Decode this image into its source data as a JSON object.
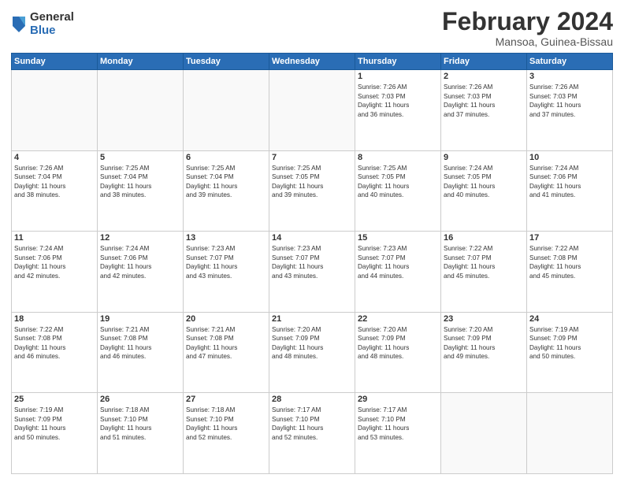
{
  "logo": {
    "general": "General",
    "blue": "Blue"
  },
  "header": {
    "title": "February 2024",
    "subtitle": "Mansoa, Guinea-Bissau"
  },
  "weekdays": [
    "Sunday",
    "Monday",
    "Tuesday",
    "Wednesday",
    "Thursday",
    "Friday",
    "Saturday"
  ],
  "weeks": [
    [
      {
        "day": "",
        "info": ""
      },
      {
        "day": "",
        "info": ""
      },
      {
        "day": "",
        "info": ""
      },
      {
        "day": "",
        "info": ""
      },
      {
        "day": "1",
        "info": "Sunrise: 7:26 AM\nSunset: 7:03 PM\nDaylight: 11 hours\nand 36 minutes."
      },
      {
        "day": "2",
        "info": "Sunrise: 7:26 AM\nSunset: 7:03 PM\nDaylight: 11 hours\nand 37 minutes."
      },
      {
        "day": "3",
        "info": "Sunrise: 7:26 AM\nSunset: 7:03 PM\nDaylight: 11 hours\nand 37 minutes."
      }
    ],
    [
      {
        "day": "4",
        "info": "Sunrise: 7:26 AM\nSunset: 7:04 PM\nDaylight: 11 hours\nand 38 minutes."
      },
      {
        "day": "5",
        "info": "Sunrise: 7:25 AM\nSunset: 7:04 PM\nDaylight: 11 hours\nand 38 minutes."
      },
      {
        "day": "6",
        "info": "Sunrise: 7:25 AM\nSunset: 7:04 PM\nDaylight: 11 hours\nand 39 minutes."
      },
      {
        "day": "7",
        "info": "Sunrise: 7:25 AM\nSunset: 7:05 PM\nDaylight: 11 hours\nand 39 minutes."
      },
      {
        "day": "8",
        "info": "Sunrise: 7:25 AM\nSunset: 7:05 PM\nDaylight: 11 hours\nand 40 minutes."
      },
      {
        "day": "9",
        "info": "Sunrise: 7:24 AM\nSunset: 7:05 PM\nDaylight: 11 hours\nand 40 minutes."
      },
      {
        "day": "10",
        "info": "Sunrise: 7:24 AM\nSunset: 7:06 PM\nDaylight: 11 hours\nand 41 minutes."
      }
    ],
    [
      {
        "day": "11",
        "info": "Sunrise: 7:24 AM\nSunset: 7:06 PM\nDaylight: 11 hours\nand 42 minutes."
      },
      {
        "day": "12",
        "info": "Sunrise: 7:24 AM\nSunset: 7:06 PM\nDaylight: 11 hours\nand 42 minutes."
      },
      {
        "day": "13",
        "info": "Sunrise: 7:23 AM\nSunset: 7:07 PM\nDaylight: 11 hours\nand 43 minutes."
      },
      {
        "day": "14",
        "info": "Sunrise: 7:23 AM\nSunset: 7:07 PM\nDaylight: 11 hours\nand 43 minutes."
      },
      {
        "day": "15",
        "info": "Sunrise: 7:23 AM\nSunset: 7:07 PM\nDaylight: 11 hours\nand 44 minutes."
      },
      {
        "day": "16",
        "info": "Sunrise: 7:22 AM\nSunset: 7:07 PM\nDaylight: 11 hours\nand 45 minutes."
      },
      {
        "day": "17",
        "info": "Sunrise: 7:22 AM\nSunset: 7:08 PM\nDaylight: 11 hours\nand 45 minutes."
      }
    ],
    [
      {
        "day": "18",
        "info": "Sunrise: 7:22 AM\nSunset: 7:08 PM\nDaylight: 11 hours\nand 46 minutes."
      },
      {
        "day": "19",
        "info": "Sunrise: 7:21 AM\nSunset: 7:08 PM\nDaylight: 11 hours\nand 46 minutes."
      },
      {
        "day": "20",
        "info": "Sunrise: 7:21 AM\nSunset: 7:08 PM\nDaylight: 11 hours\nand 47 minutes."
      },
      {
        "day": "21",
        "info": "Sunrise: 7:20 AM\nSunset: 7:09 PM\nDaylight: 11 hours\nand 48 minutes."
      },
      {
        "day": "22",
        "info": "Sunrise: 7:20 AM\nSunset: 7:09 PM\nDaylight: 11 hours\nand 48 minutes."
      },
      {
        "day": "23",
        "info": "Sunrise: 7:20 AM\nSunset: 7:09 PM\nDaylight: 11 hours\nand 49 minutes."
      },
      {
        "day": "24",
        "info": "Sunrise: 7:19 AM\nSunset: 7:09 PM\nDaylight: 11 hours\nand 50 minutes."
      }
    ],
    [
      {
        "day": "25",
        "info": "Sunrise: 7:19 AM\nSunset: 7:09 PM\nDaylight: 11 hours\nand 50 minutes."
      },
      {
        "day": "26",
        "info": "Sunrise: 7:18 AM\nSunset: 7:10 PM\nDaylight: 11 hours\nand 51 minutes."
      },
      {
        "day": "27",
        "info": "Sunrise: 7:18 AM\nSunset: 7:10 PM\nDaylight: 11 hours\nand 52 minutes."
      },
      {
        "day": "28",
        "info": "Sunrise: 7:17 AM\nSunset: 7:10 PM\nDaylight: 11 hours\nand 52 minutes."
      },
      {
        "day": "29",
        "info": "Sunrise: 7:17 AM\nSunset: 7:10 PM\nDaylight: 11 hours\nand 53 minutes."
      },
      {
        "day": "",
        "info": ""
      },
      {
        "day": "",
        "info": ""
      }
    ]
  ]
}
